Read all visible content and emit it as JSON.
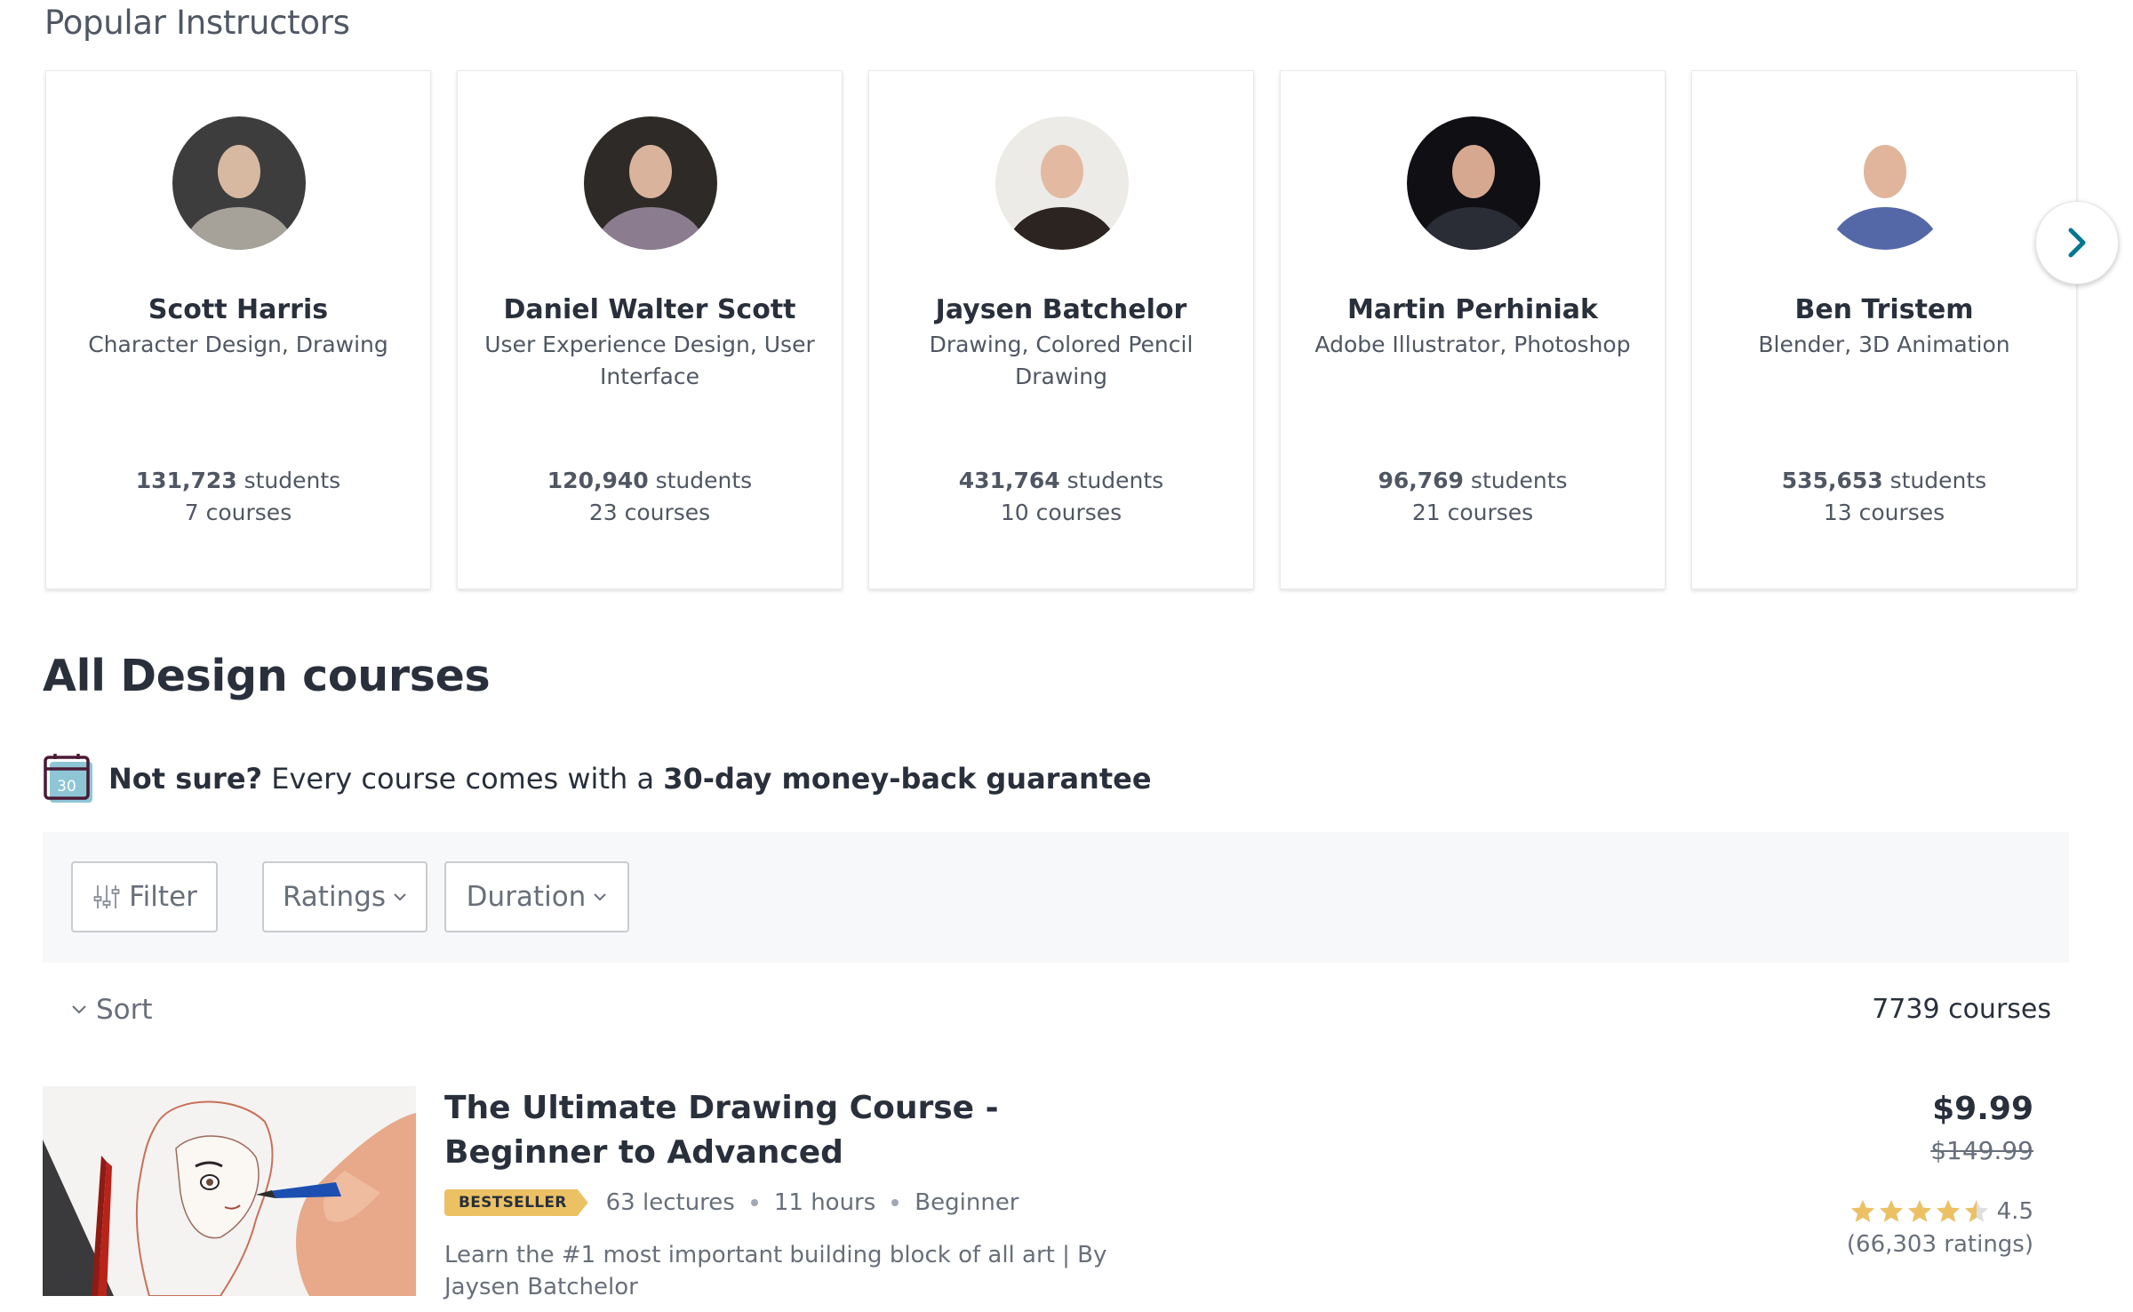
{
  "popular_instructors": {
    "title": "Popular Instructors",
    "next_button": "next-arrow",
    "instructors": [
      {
        "name": "Scott Harris",
        "topics": "Character Design, Drawing",
        "students_count": "131,723",
        "students_label": "students",
        "courses": "7 courses"
      },
      {
        "name": "Daniel Walter Scott",
        "topics": "User Experience Design, User Interface",
        "students_count": "120,940",
        "students_label": "students",
        "courses": "23 courses"
      },
      {
        "name": "Jaysen Batchelor",
        "topics": "Drawing, Colored Pencil Drawing",
        "students_count": "431,764",
        "students_label": "students",
        "courses": "10 courses"
      },
      {
        "name": "Martin Perhiniak",
        "topics": "Adobe Illustrator, Photoshop",
        "students_count": "96,769",
        "students_label": "students",
        "courses": "21 courses"
      },
      {
        "name": "Ben Tristem",
        "topics": "Blender, 3D Animation",
        "students_count": "535,653",
        "students_label": "students",
        "courses": "13 courses"
      }
    ]
  },
  "all_courses": {
    "title": "All Design courses",
    "guarantee": {
      "icon": "calendar-icon",
      "icon_text": "30",
      "lead": "Not sure?",
      "middle": " Every course comes with a ",
      "bold": "30-day money-back guarantee"
    },
    "filters": {
      "filter_label": "Filter",
      "ratings_label": "Ratings",
      "duration_label": "Duration"
    },
    "sort_label": "Sort",
    "course_count": "7739 courses"
  },
  "courses": [
    {
      "title": "The Ultimate Drawing Course - Beginner to Advanced",
      "badge": "BESTSELLER",
      "lectures": "63 lectures",
      "duration": "11 hours",
      "level": "Beginner",
      "description": "Learn the #1 most important building block of all art | By Jaysen Batchelor",
      "price": "$9.99",
      "original_price": "$149.99",
      "rating": 4.5,
      "rating_label": "4.5",
      "ratings_count": "(66,303 ratings)"
    }
  ],
  "colors": {
    "accent": "#007791",
    "badge": "#ECC164",
    "star": "#ECC164",
    "star_empty": "#DEDFE0",
    "text_dark": "#29303B",
    "text_muted": "#686F7A",
    "filter_bar_bg": "#F7F8FA"
  }
}
